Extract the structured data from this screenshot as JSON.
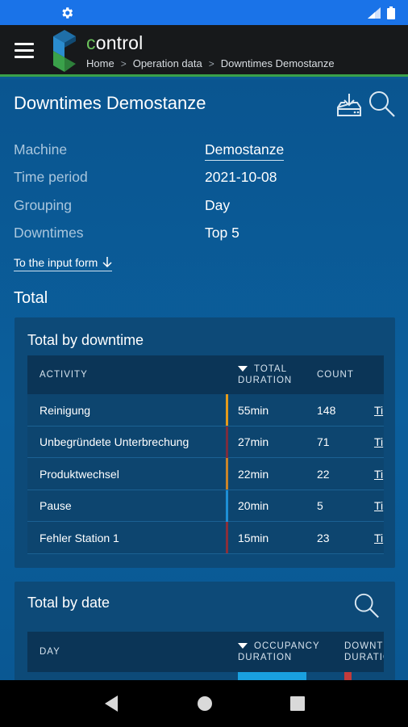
{
  "app": {
    "brand_c": "c",
    "brand_rest": "ontrol"
  },
  "breadcrumb": [
    "Home",
    "Operation data",
    "Downtimes Demostanze"
  ],
  "page_title": "Downtimes Demostanze",
  "fields": [
    {
      "label": "Machine",
      "value": "Demostanze"
    },
    {
      "label": "Time period",
      "value": "2021-10-08"
    },
    {
      "label": "Grouping",
      "value": "Day"
    },
    {
      "label": "Downtimes",
      "value": "Top 5"
    }
  ],
  "input_link": "To the input form",
  "section_title": "Total",
  "card1": {
    "title": "Total by downtime",
    "columns": [
      "ACTIVITY",
      "TOTAL",
      "DURATION",
      "COUNT"
    ],
    "rows": [
      {
        "activity": "Reinigung",
        "duration": "55min",
        "count": "148",
        "link": "Ti",
        "accent": "#e39a1b"
      },
      {
        "activity": "Unbegründete Unterbrechung",
        "duration": "27min",
        "count": "71",
        "link": "Ti",
        "accent": "#7b2d3e"
      },
      {
        "activity": "Produktwechsel",
        "duration": "22min",
        "count": "22",
        "link": "Ti",
        "accent": "#c9842a"
      },
      {
        "activity": "Pause",
        "duration": "20min",
        "count": "5",
        "link": "Ti",
        "accent": "#1d8fd6"
      },
      {
        "activity": "Fehler Station 1",
        "duration": "15min",
        "count": "23",
        "link": "Ti",
        "accent": "#8a2f3a"
      }
    ]
  },
  "card2": {
    "title": "Total by date",
    "columns": [
      "DAY",
      "OCCUPANCY",
      "DURATION",
      "DOWNTI",
      "DURATIO"
    ]
  },
  "colors": {
    "statusbar": "#1a73e8",
    "accent_green": "#3aa14a",
    "bg": "#0b5a92"
  }
}
